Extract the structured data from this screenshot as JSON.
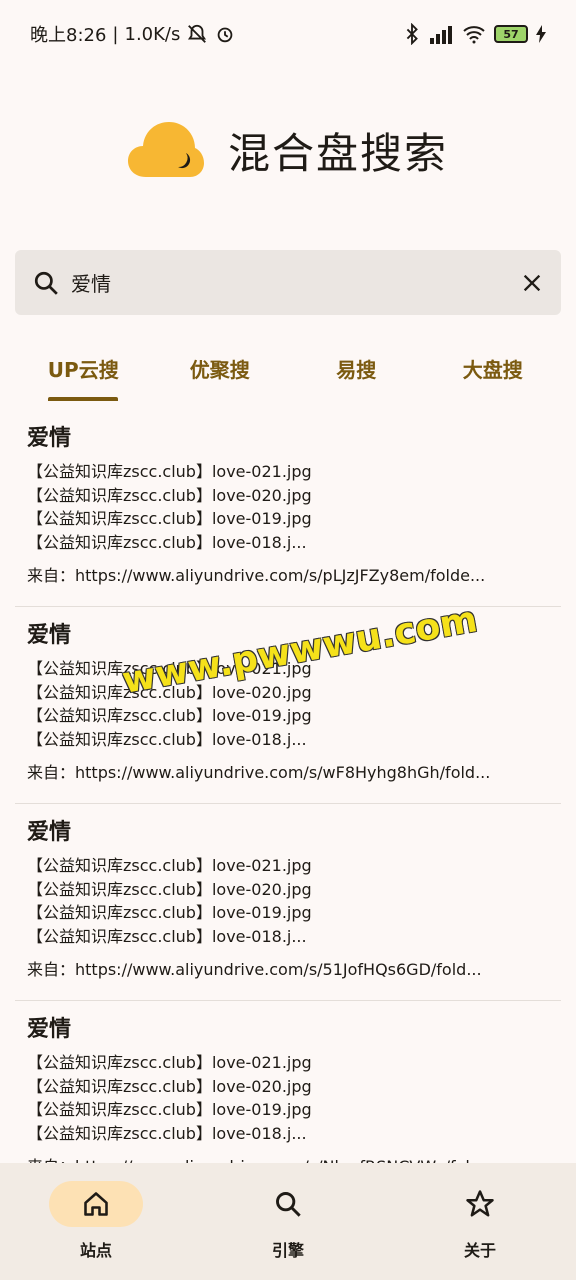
{
  "status_bar": {
    "time": "晚上8:26",
    "network_speed": "1.0K/s",
    "battery": "57"
  },
  "header": {
    "title": "混合盘搜索"
  },
  "search": {
    "value": "爱情",
    "placeholder": ""
  },
  "tabs": [
    {
      "label": "UP云搜"
    },
    {
      "label": "优聚搜"
    },
    {
      "label": "易搜"
    },
    {
      "label": "大盘搜"
    }
  ],
  "results": [
    {
      "title": "爱情",
      "files": [
        "【公益知识库zscc.club】love-021.jpg",
        "【公益知识库zscc.club】love-020.jpg",
        "【公益知识库zscc.club】love-019.jpg",
        "【公益知识库zscc.club】love-018.j..."
      ],
      "source": "来自：https://www.aliyundrive.com/s/pLJzJFZy8em/folde..."
    },
    {
      "title": "爱情",
      "files": [
        "【公益知识库zscc.club】love-021.jpg",
        "【公益知识库zscc.club】love-020.jpg",
        "【公益知识库zscc.club】love-019.jpg",
        "【公益知识库zscc.club】love-018.j..."
      ],
      "source": "来自：https://www.aliyundrive.com/s/wF8Hyhg8hGh/fold..."
    },
    {
      "title": "爱情",
      "files": [
        "【公益知识库zscc.club】love-021.jpg",
        "【公益知识库zscc.club】love-020.jpg",
        "【公益知识库zscc.club】love-019.jpg",
        "【公益知识库zscc.club】love-018.j..."
      ],
      "source": "来自：https://www.aliyundrive.com/s/51JofHQs6GD/fold..."
    },
    {
      "title": "爱情",
      "files": [
        "【公益知识库zscc.club】love-021.jpg",
        "【公益知识库zscc.club】love-020.jpg",
        "【公益知识库zscc.club】love-019.jpg",
        "【公益知识库zscc.club】love-018.j..."
      ],
      "source": "来自：https://www.aliyundrive.com/s/NkmfRSNCVWz/fol..."
    }
  ],
  "watermark": "www.pwwwu.com",
  "bottom_nav": [
    {
      "label": "站点",
      "icon": "home-icon"
    },
    {
      "label": "引擎",
      "icon": "search-icon"
    },
    {
      "label": "关于",
      "icon": "star-icon"
    }
  ],
  "colors": {
    "accent": "#7b5a10",
    "background": "#fdf8f6",
    "logo": "#f7b733",
    "nav_active": "#fde1b4"
  }
}
